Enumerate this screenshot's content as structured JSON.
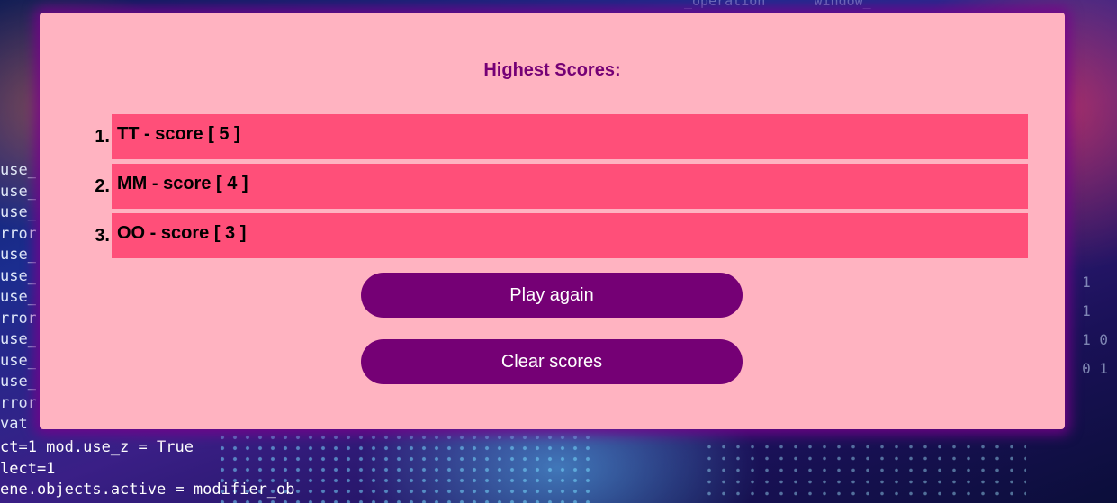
{
  "highscores": {
    "heading": "Highest Scores:",
    "entries": [
      {
        "rank": "1.",
        "text": "TT - score [ 5 ]"
      },
      {
        "rank": "2.",
        "text": "MM - score [ 4 ]"
      },
      {
        "rank": "3.",
        "text": "OO - score [ 3 ]"
      }
    ]
  },
  "actions": {
    "play_again_label": "Play again",
    "clear_scores_label": "Clear scores"
  },
  "background": {
    "code_lines_left": [
      "use_",
      "use_",
      "use_",
      "rror",
      "use_",
      "use_",
      "use_",
      "rror",
      "use_",
      "use_",
      "use_",
      "rror",
      "vat"
    ],
    "code_lines_bottom": [
      "ct=1 mod.use_z = True",
      "lect=1",
      "ene.objects.active = modifier_ob"
    ]
  },
  "colors": {
    "card": "#ffb3c1",
    "row": "#ff4f79",
    "accent": "#750075",
    "button_text": "#ffffff"
  }
}
